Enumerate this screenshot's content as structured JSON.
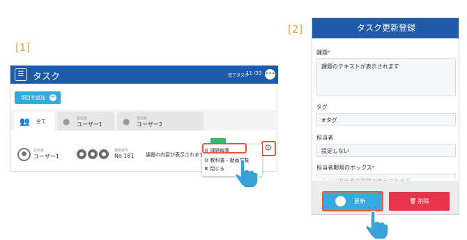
{
  "labels": {
    "step1": "[1]",
    "step2": "[2]"
  },
  "panel1": {
    "header": {
      "menu_icon": "list-icon",
      "title": "タスク",
      "done_label": "完了タスク",
      "count": "11 /33",
      "circle_icon": "ellipsis-icon"
    },
    "add_button": {
      "label": "項目を追加",
      "icon": "plus-circle-icon"
    },
    "tabs": [
      {
        "small": "",
        "label": "全て",
        "icon": "group-icon"
      },
      {
        "small": "担当者",
        "label": "ユーザー1",
        "icon": "user-icon"
      },
      {
        "small": "担当者",
        "label": "ユーザー2",
        "icon": "user-icon"
      }
    ],
    "row": {
      "assignee_small": "担当者",
      "assignee": "ユーザー1",
      "number_small": "課題番号",
      "number": "No 181",
      "task_text": "課題の内容が表示されます"
    },
    "context_menu": [
      {
        "label": "課題編集",
        "icon": "gears-icon"
      },
      {
        "label": "教科書・動画閲覧",
        "icon": "book-icon"
      },
      {
        "label": "閉じる",
        "icon": "close-icon"
      }
    ],
    "gear_icon": "gear-icon"
  },
  "panel2": {
    "title": "タスク更新登録",
    "fields": {
      "subject_label": "課題",
      "subject_value": "課題のテキストが表示されます",
      "tag_label": "タグ",
      "tag_value": "#タグ",
      "assignee_label": "担当者",
      "assignee_value": "設定しない",
      "deadline_label": "担当者期限のボックス",
      "deadline_value": "ここに担当者の期限が表示されます"
    },
    "update_button": "更新",
    "delete_button": "削除",
    "required_mark": "*"
  },
  "colors": {
    "header_blue": "#1f5ba8",
    "accent_cyan": "#35a8df",
    "highlight": "#e65a3a",
    "delete_red": "#e8344a",
    "label_orange": "#e8a33d"
  }
}
